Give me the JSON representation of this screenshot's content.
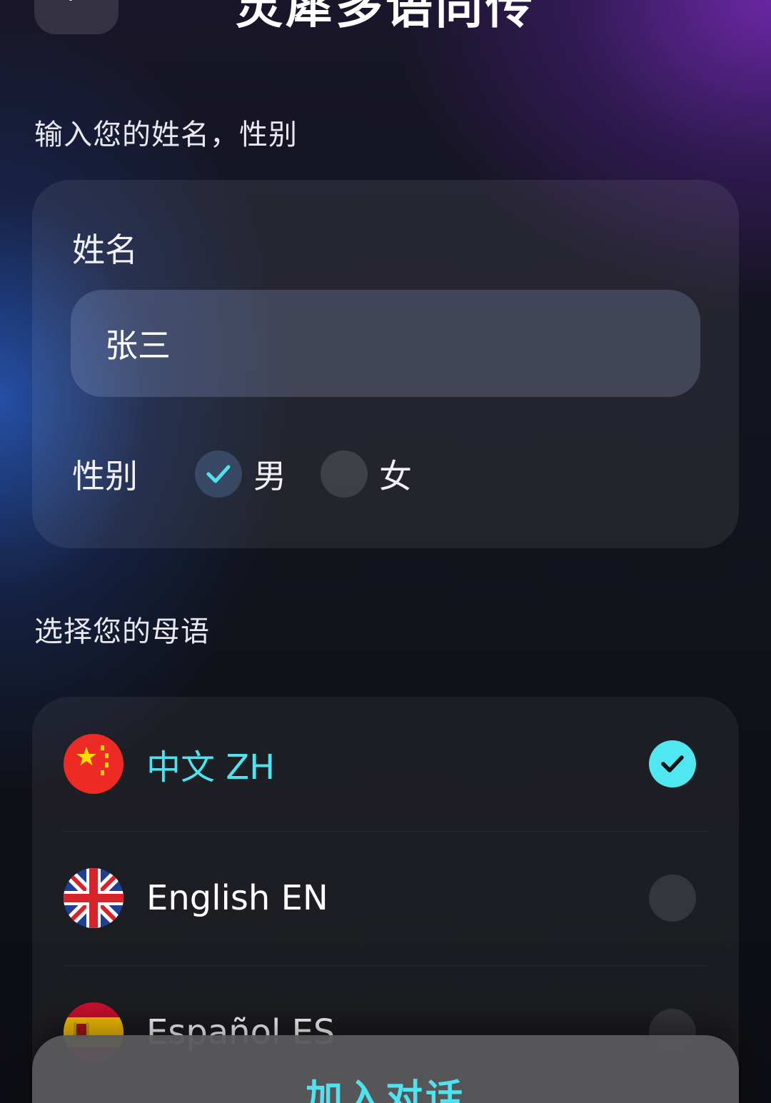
{
  "header": {
    "title": "灵犀多语同传",
    "back_icon": "chevron-left-icon"
  },
  "profile_section": {
    "heading": "输入您的姓名，性别",
    "name_label": "姓名",
    "name_value": "张三",
    "gender_label": "性别",
    "gender_options": [
      {
        "label": "男",
        "selected": true
      },
      {
        "label": "女",
        "selected": false
      }
    ]
  },
  "language_section": {
    "heading": "选择您的母语",
    "languages": [
      {
        "name": "中文 ZH",
        "flag": "china-flag-icon",
        "selected": true
      },
      {
        "name": "English EN",
        "flag": "uk-flag-icon",
        "selected": false
      },
      {
        "name": "Español ES",
        "flag": "spain-flag-icon",
        "selected": false
      }
    ]
  },
  "footer": {
    "join_label": "加入对话"
  },
  "colors": {
    "accent": "#4fe3ef",
    "card": "#24262f",
    "button": "#58585c"
  }
}
